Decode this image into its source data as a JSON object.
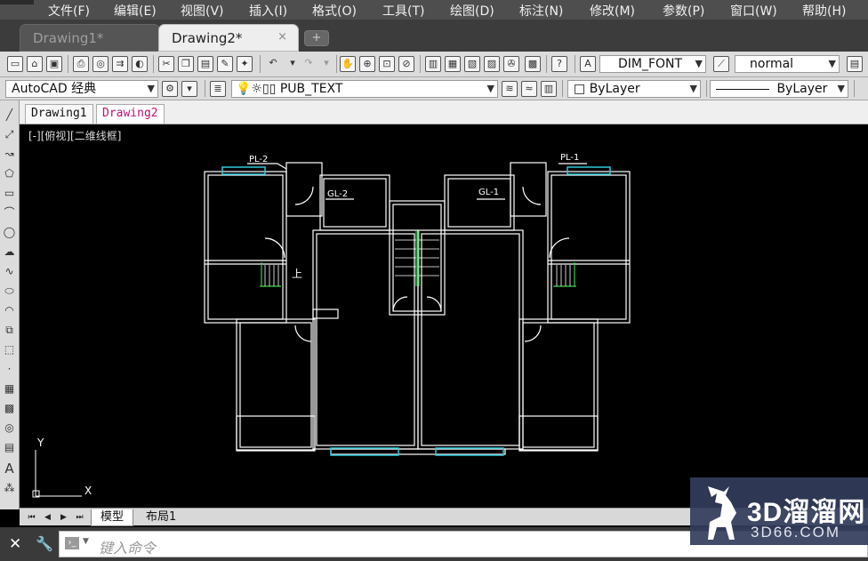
{
  "menu": [
    "文件(F)",
    "编辑(E)",
    "视图(V)",
    "插入(I)",
    "格式(O)",
    "工具(T)",
    "绘图(D)",
    "标注(N)",
    "修改(M)",
    "参数(P)",
    "窗口(W)",
    "帮助(H)"
  ],
  "doc_tabs": [
    {
      "label": "Drawing1*",
      "active": false
    },
    {
      "label": "Drawing2*",
      "active": true
    }
  ],
  "doc_tab_close": "×",
  "new_tab_symbol": "+",
  "toolbar": {
    "text_style": "DIM_FONT",
    "dim_style": "normal",
    "workspace": "AutoCAD 经典",
    "layer": "PUB_TEXT",
    "color": "ByLayer",
    "linetype": "ByLayer"
  },
  "file_tabs": [
    "Drawing1",
    "Drawing2"
  ],
  "viewport_label": "[-][俯视][二维线框]",
  "drawing_labels": {
    "pl2": "PL-2",
    "pl1": "PL-1",
    "gl2": "GL-2",
    "gl1": "GL-1",
    "up": "上"
  },
  "ucs": {
    "x": "X",
    "y": "Y"
  },
  "layout_tabs": [
    "模型",
    "布局1"
  ],
  "command": {
    "placeholder": "键入命令"
  },
  "watermark": {
    "title": "3D溜溜网",
    "sub": "3D66.COM"
  },
  "colors": {
    "menubar": "#4e4e4e",
    "toolbar": "#dcdcdc",
    "canvas": "#000000",
    "wall": "#ffffff",
    "window": "#2ec7d8",
    "stair_green": "#35d34a",
    "active_file_tab": "#c01070"
  },
  "icons": [
    "new-icon",
    "open-icon",
    "save-icon",
    "print-icon",
    "preview-icon",
    "publish-icon",
    "plot-3d-icon",
    "cut-icon",
    "copy-icon",
    "paste-icon",
    "match-properties-icon",
    "block-editor-icon",
    "undo-icon",
    "redo-icon",
    "pan-icon",
    "zoom-realtime-icon",
    "zoom-window-icon",
    "zoom-previous-icon",
    "properties-icon",
    "design-center-icon",
    "tool-palettes-icon",
    "sheet-set-icon",
    "markup-icon",
    "calculator-icon",
    "help-icon"
  ]
}
